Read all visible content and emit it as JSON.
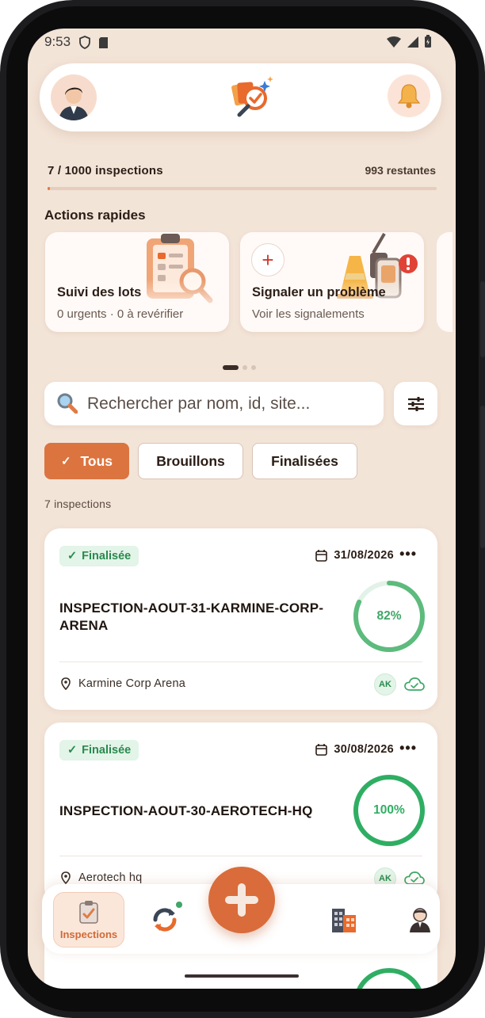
{
  "status_bar": {
    "time": "9:53"
  },
  "header": {
    "avatar_alt": "avatar",
    "logo_alt": "app-logo"
  },
  "progress": {
    "label": "7 / 1000 inspections",
    "remaining": "993 restantes",
    "fraction": 0.007
  },
  "quick_actions": {
    "title": "Actions rapides",
    "cards": [
      {
        "title": "Suivi des lots",
        "subtitle": "0 urgents · 0 à revérifier",
        "icon": "clipboard-magnifier-icon"
      },
      {
        "title": "Signaler un problème",
        "subtitle": "Voir les signalements",
        "icon": "warning-tools-icon",
        "plus": "+"
      }
    ]
  },
  "search": {
    "placeholder": "Rechercher par nom, id, site..."
  },
  "filters": {
    "chips": [
      "Tous",
      "Brouillons",
      "Finalisées"
    ],
    "active": "Tous",
    "check": "✓"
  },
  "count_label": "7 inspections",
  "inspections": [
    {
      "status": "Finalisée",
      "date": "31/08/2026",
      "title": "INSPECTION-AOUT-31-KARMINE-CORP-ARENA",
      "progress_label": "82%",
      "progress": 0.82,
      "site": "Karmine Corp Arena",
      "initials": "AK"
    },
    {
      "status": "Finalisée",
      "date": "30/08/2026",
      "title": "INSPECTION-AOUT-30-AEROTECH-HQ",
      "progress_label": "100%",
      "progress": 1.0,
      "site": "Aerotech hq",
      "initials": "AK"
    }
  ],
  "more": "•••",
  "bottom_nav": {
    "items": [
      "Inspections",
      "sync",
      "add",
      "buildings",
      "profile"
    ],
    "active_label": "Inspections"
  },
  "colors": {
    "accent": "#dc7440",
    "success": "#3fa767",
    "background": "#f3e4d8"
  }
}
